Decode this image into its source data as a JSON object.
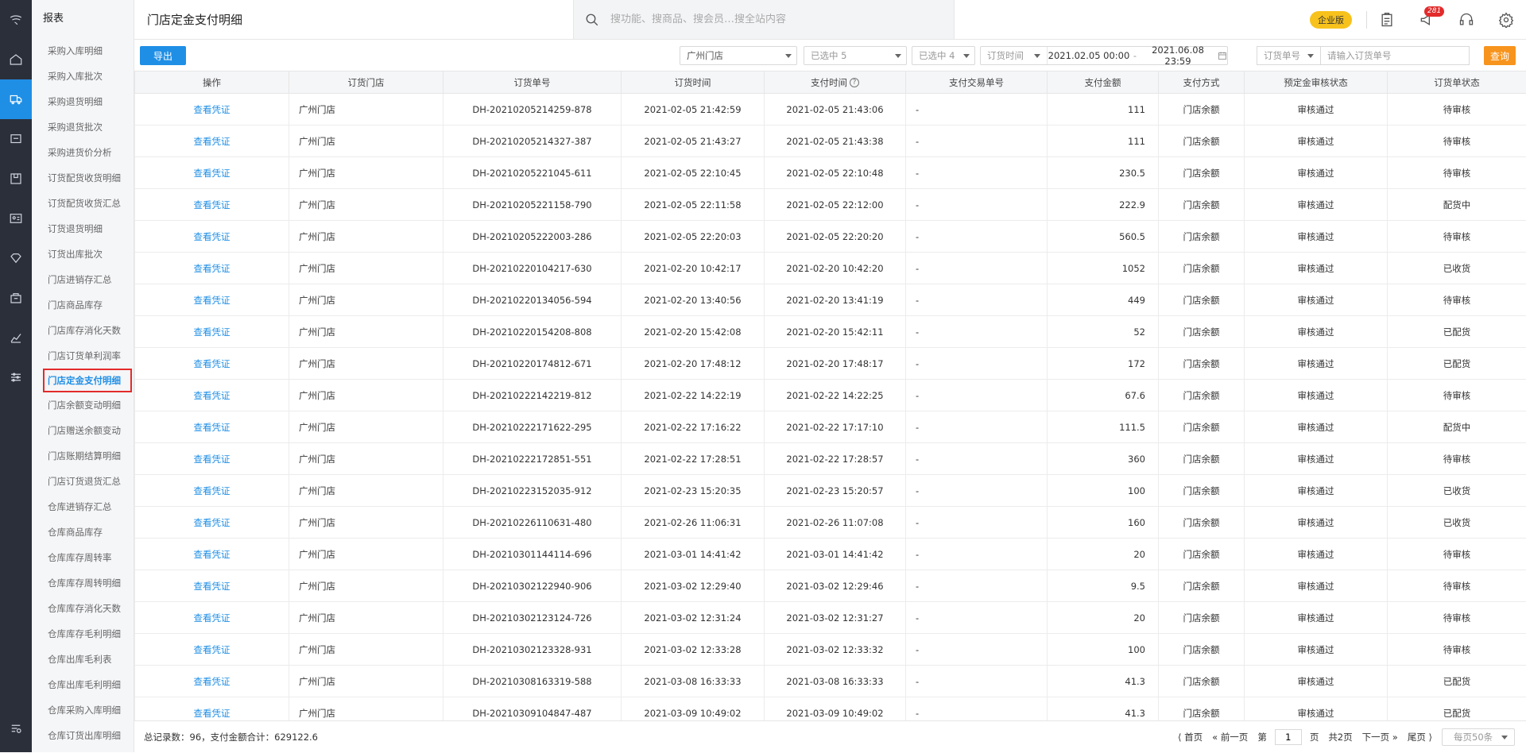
{
  "header": {
    "page_title": "门店定金支付明细",
    "search_placeholder": "搜功能、搜商品、搜会员…搜全站内容",
    "edition_badge": "企业版",
    "notification_count": "281"
  },
  "menu": {
    "title": "报表",
    "items": [
      {
        "label": "采购入库明细"
      },
      {
        "label": "采购入库批次"
      },
      {
        "label": "采购退货明细"
      },
      {
        "label": "采购退货批次"
      },
      {
        "label": "采购进货价分析"
      },
      {
        "label": "订货配货收货明细"
      },
      {
        "label": "订货配货收货汇总"
      },
      {
        "label": "订货退货明细"
      },
      {
        "label": "订货出库批次"
      },
      {
        "label": "门店进销存汇总"
      },
      {
        "label": "门店商品库存"
      },
      {
        "label": "门店库存消化天数"
      },
      {
        "label": "门店订货单利润率"
      },
      {
        "label": "门店定金支付明细",
        "active": true
      },
      {
        "label": "门店余额变动明细"
      },
      {
        "label": "门店赠送余额变动"
      },
      {
        "label": "门店账期结算明细"
      },
      {
        "label": "门店订货退货汇总"
      },
      {
        "label": "仓库进销存汇总"
      },
      {
        "label": "仓库商品库存"
      },
      {
        "label": "仓库库存周转率"
      },
      {
        "label": "仓库库存周转明细"
      },
      {
        "label": "仓库库存消化天数"
      },
      {
        "label": "仓库库存毛利明细"
      },
      {
        "label": "仓库出库毛利表"
      },
      {
        "label": "仓库出库毛利明细"
      },
      {
        "label": "仓库采购入库明细"
      },
      {
        "label": "仓库订货出库明细"
      }
    ]
  },
  "toolbar": {
    "export_label": "导出",
    "store_select": "广州门店",
    "status_select_1": "已选中 5",
    "status_select_2": "已选中 4",
    "date_type": "订货时间",
    "date_from": "2021.02.05 00:00",
    "date_sep": "-",
    "date_to": "2021.06.08 23:59",
    "order_field": "订货单号",
    "order_placeholder": "请输入订货单号",
    "query_label": "查询"
  },
  "table": {
    "columns": [
      "操作",
      "订货门店",
      "订货单号",
      "订货时间",
      "支付时间",
      "支付交易单号",
      "支付金额",
      "支付方式",
      "预定金审核状态",
      "订货单状态"
    ],
    "rows": [
      [
        "查看凭证",
        "广州门店",
        "DH-20210205214259-878",
        "2021-02-05 21:42:59",
        "2021-02-05 21:43:06",
        "-",
        "111",
        "门店余额",
        "审核通过",
        "待审核"
      ],
      [
        "查看凭证",
        "广州门店",
        "DH-20210205214327-387",
        "2021-02-05 21:43:27",
        "2021-02-05 21:43:38",
        "-",
        "111",
        "门店余额",
        "审核通过",
        "待审核"
      ],
      [
        "查看凭证",
        "广州门店",
        "DH-20210205221045-611",
        "2021-02-05 22:10:45",
        "2021-02-05 22:10:48",
        "-",
        "230.5",
        "门店余额",
        "审核通过",
        "待审核"
      ],
      [
        "查看凭证",
        "广州门店",
        "DH-20210205221158-790",
        "2021-02-05 22:11:58",
        "2021-02-05 22:12:00",
        "-",
        "222.9",
        "门店余额",
        "审核通过",
        "配货中"
      ],
      [
        "查看凭证",
        "广州门店",
        "DH-20210205222003-286",
        "2021-02-05 22:20:03",
        "2021-02-05 22:20:20",
        "-",
        "560.5",
        "门店余额",
        "审核通过",
        "待审核"
      ],
      [
        "查看凭证",
        "广州门店",
        "DH-20210220104217-630",
        "2021-02-20 10:42:17",
        "2021-02-20 10:42:20",
        "-",
        "1052",
        "门店余额",
        "审核通过",
        "已收货"
      ],
      [
        "查看凭证",
        "广州门店",
        "DH-20210220134056-594",
        "2021-02-20 13:40:56",
        "2021-02-20 13:41:19",
        "-",
        "449",
        "门店余额",
        "审核通过",
        "待审核"
      ],
      [
        "查看凭证",
        "广州门店",
        "DH-20210220154208-808",
        "2021-02-20 15:42:08",
        "2021-02-20 15:42:11",
        "-",
        "52",
        "门店余额",
        "审核通过",
        "已配货"
      ],
      [
        "查看凭证",
        "广州门店",
        "DH-20210220174812-671",
        "2021-02-20 17:48:12",
        "2021-02-20 17:48:17",
        "-",
        "172",
        "门店余额",
        "审核通过",
        "已配货"
      ],
      [
        "查看凭证",
        "广州门店",
        "DH-20210222142219-812",
        "2021-02-22 14:22:19",
        "2021-02-22 14:22:25",
        "-",
        "67.6",
        "门店余额",
        "审核通过",
        "待审核"
      ],
      [
        "查看凭证",
        "广州门店",
        "DH-20210222171622-295",
        "2021-02-22 17:16:22",
        "2021-02-22 17:17:10",
        "-",
        "111.5",
        "门店余额",
        "审核通过",
        "配货中"
      ],
      [
        "查看凭证",
        "广州门店",
        "DH-20210222172851-551",
        "2021-02-22 17:28:51",
        "2021-02-22 17:28:57",
        "-",
        "360",
        "门店余额",
        "审核通过",
        "待审核"
      ],
      [
        "查看凭证",
        "广州门店",
        "DH-20210223152035-912",
        "2021-02-23 15:20:35",
        "2021-02-23 15:20:57",
        "-",
        "100",
        "门店余额",
        "审核通过",
        "已收货"
      ],
      [
        "查看凭证",
        "广州门店",
        "DH-20210226110631-480",
        "2021-02-26 11:06:31",
        "2021-02-26 11:07:08",
        "-",
        "160",
        "门店余额",
        "审核通过",
        "已收货"
      ],
      [
        "查看凭证",
        "广州门店",
        "DH-20210301144114-696",
        "2021-03-01 14:41:42",
        "2021-03-01 14:41:42",
        "-",
        "20",
        "门店余额",
        "审核通过",
        "待审核"
      ],
      [
        "查看凭证",
        "广州门店",
        "DH-20210302122940-906",
        "2021-03-02 12:29:40",
        "2021-03-02 12:29:46",
        "-",
        "9.5",
        "门店余额",
        "审核通过",
        "待审核"
      ],
      [
        "查看凭证",
        "广州门店",
        "DH-20210302123124-726",
        "2021-03-02 12:31:24",
        "2021-03-02 12:31:27",
        "-",
        "20",
        "门店余额",
        "审核通过",
        "待审核"
      ],
      [
        "查看凭证",
        "广州门店",
        "DH-20210302123328-931",
        "2021-03-02 12:33:28",
        "2021-03-02 12:33:32",
        "-",
        "100",
        "门店余额",
        "审核通过",
        "待审核"
      ],
      [
        "查看凭证",
        "广州门店",
        "DH-20210308163319-588",
        "2021-03-08 16:33:33",
        "2021-03-08 16:33:33",
        "-",
        "41.3",
        "门店余额",
        "审核通过",
        "已配货"
      ],
      [
        "查看凭证",
        "广州门店",
        "DH-20210309104847-487",
        "2021-03-09 10:49:02",
        "2021-03-09 10:49:02",
        "-",
        "41.3",
        "门店余额",
        "审核通过",
        "已配货"
      ]
    ]
  },
  "footer": {
    "summary": "总记录数：96，支付金额合计：629122.6",
    "first": "首页",
    "prev": "前一页",
    "page_prefix": "第",
    "page_value": "1",
    "page_suffix": "页",
    "total_pages": "共2页",
    "next": "下一页",
    "last": "尾页",
    "page_size": "每页50条"
  },
  "colors": {
    "accent": "#1f8fe6",
    "query_button": "#f7941d",
    "badge": "#f7c21b",
    "rail_bg": "#2b2f3a",
    "highlight_border": "#e32b2b"
  },
  "icons": {
    "rail": [
      "logo-icon",
      "home-icon",
      "truck-icon",
      "cart-icon",
      "box-icon",
      "member-card-icon",
      "diamond-icon",
      "store-icon",
      "chart-icon",
      "settings-sliders-icon",
      "report-icon"
    ],
    "top": [
      "search-icon",
      "clipboard-icon",
      "megaphone-icon",
      "headset-icon",
      "gear-icon"
    ]
  }
}
